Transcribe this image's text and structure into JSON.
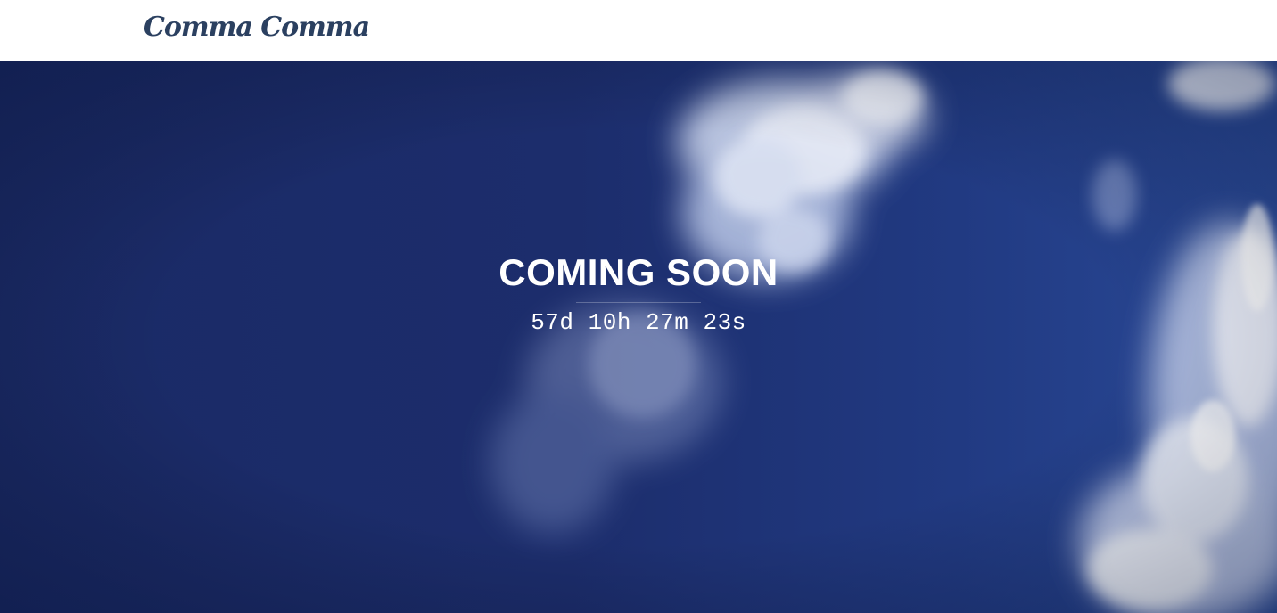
{
  "header": {
    "logo_text": "Comma Comma"
  },
  "hero": {
    "title": "COMING SOON",
    "countdown": {
      "days": "57d",
      "hours": "10h",
      "minutes": "27m",
      "seconds": "23s"
    }
  },
  "colors": {
    "logo": "#2b4060",
    "sky": "#1c2b68",
    "text": "#ffffff"
  }
}
